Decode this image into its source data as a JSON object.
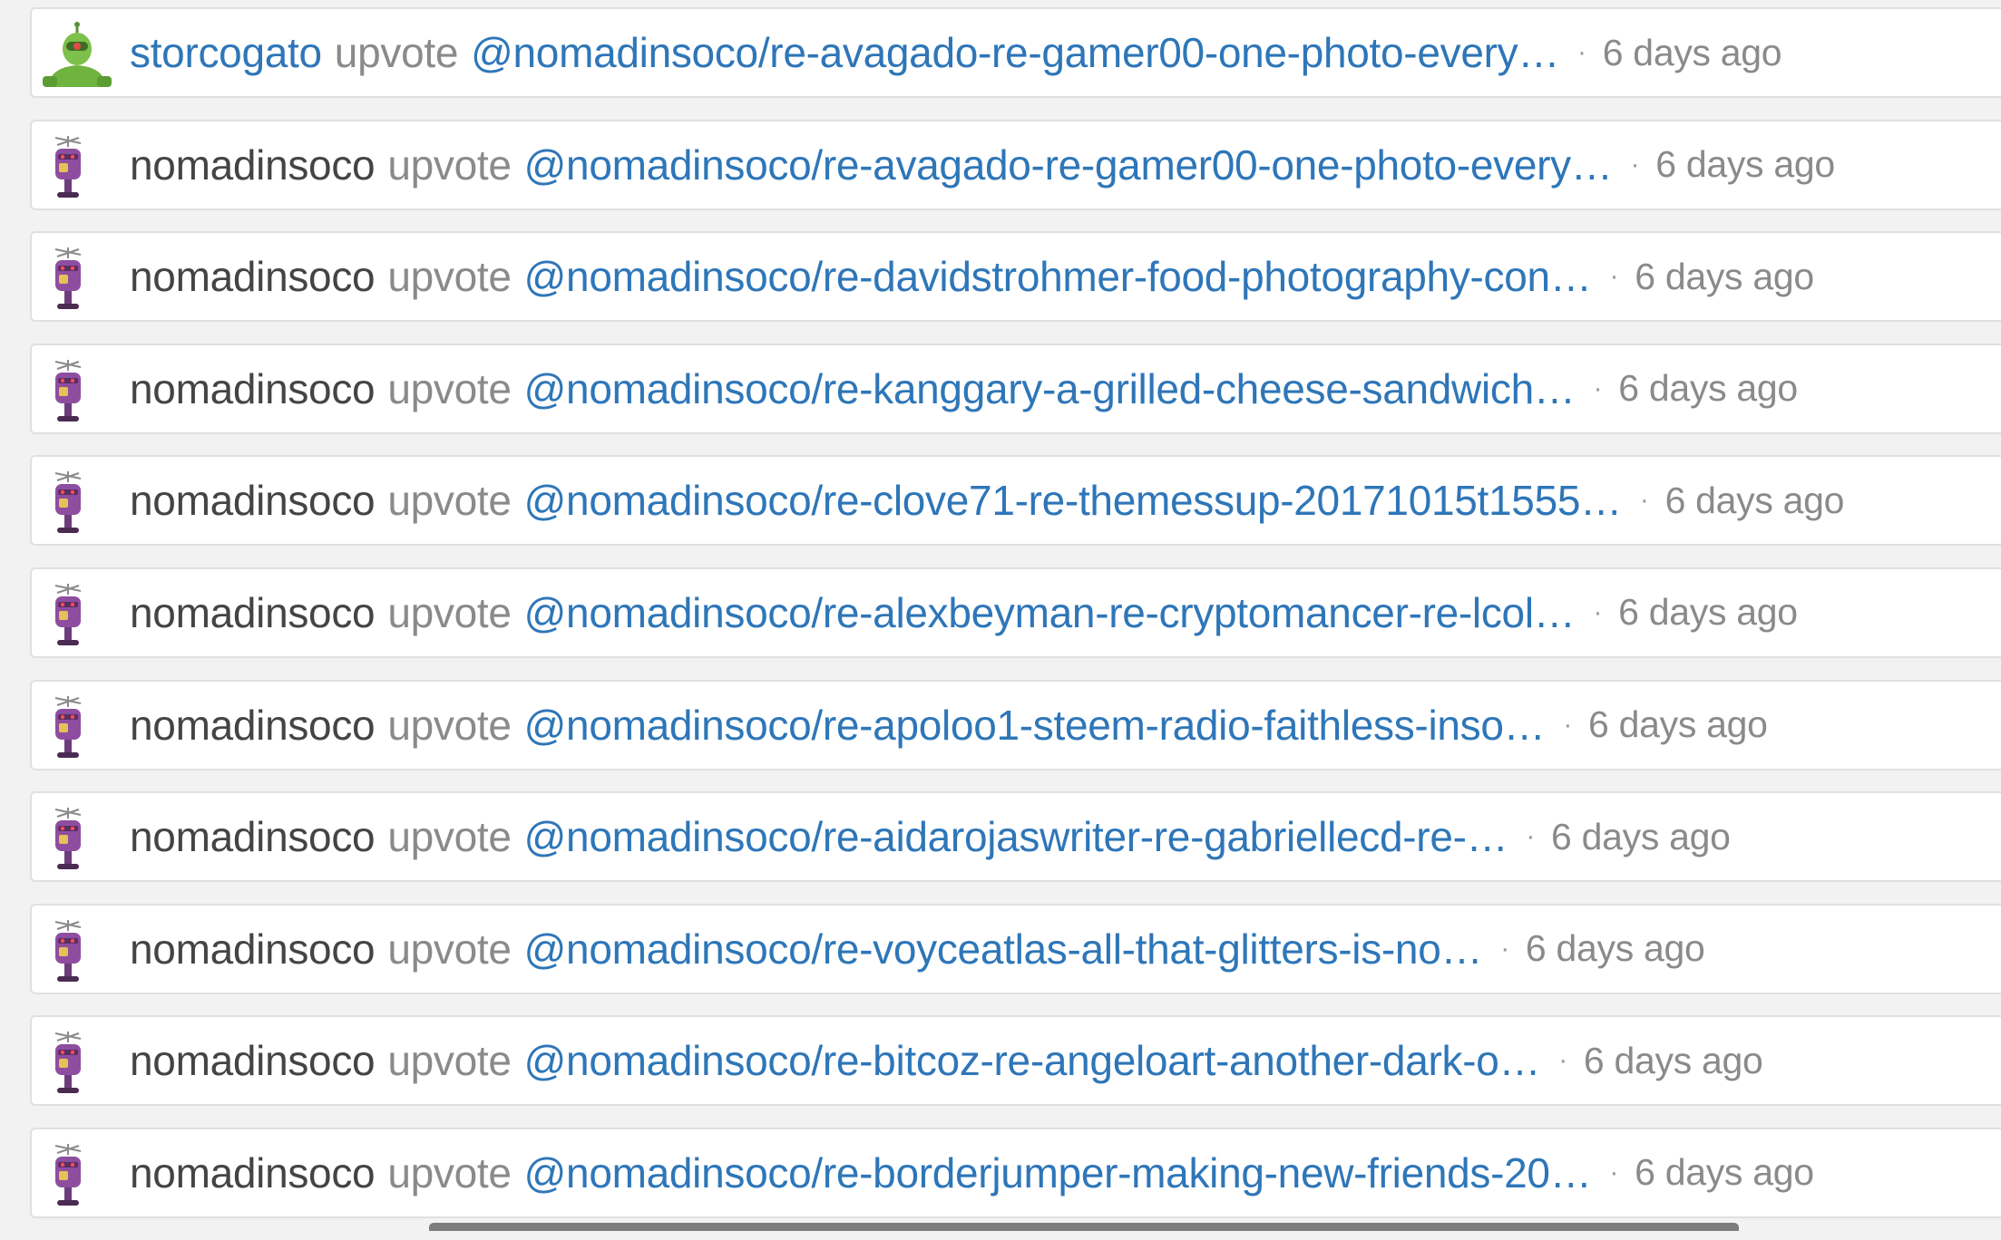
{
  "feed": {
    "items": [
      {
        "user": "storcogato",
        "action": "upvote",
        "permlink": "@nomadinsoco/re-avagado-re-gamer00-one-photo-every…",
        "separator": "·",
        "time": "6 days ago",
        "avatar": "green-robot-avatar",
        "user_is_link": true
      },
      {
        "user": "nomadinsoco",
        "action": "upvote",
        "permlink": "@nomadinsoco/re-avagado-re-gamer00-one-photo-every…",
        "separator": "·",
        "time": "6 days ago",
        "avatar": "purple-robot-avatar",
        "user_is_link": false
      },
      {
        "user": "nomadinsoco",
        "action": "upvote",
        "permlink": "@nomadinsoco/re-davidstrohmer-food-photography-con…",
        "separator": "·",
        "time": "6 days ago",
        "avatar": "purple-robot-avatar",
        "user_is_link": false
      },
      {
        "user": "nomadinsoco",
        "action": "upvote",
        "permlink": "@nomadinsoco/re-kanggary-a-grilled-cheese-sandwich…",
        "separator": "·",
        "time": "6 days ago",
        "avatar": "purple-robot-avatar",
        "user_is_link": false
      },
      {
        "user": "nomadinsoco",
        "action": "upvote",
        "permlink": "@nomadinsoco/re-clove71-re-themessup-20171015t1555…",
        "separator": "·",
        "time": "6 days ago",
        "avatar": "purple-robot-avatar",
        "user_is_link": false
      },
      {
        "user": "nomadinsoco",
        "action": "upvote",
        "permlink": "@nomadinsoco/re-alexbeyman-re-cryptomancer-re-lcol…",
        "separator": "·",
        "time": "6 days ago",
        "avatar": "purple-robot-avatar",
        "user_is_link": false
      },
      {
        "user": "nomadinsoco",
        "action": "upvote",
        "permlink": "@nomadinsoco/re-apoloo1-steem-radio-faithless-inso…",
        "separator": "·",
        "time": "6 days ago",
        "avatar": "purple-robot-avatar",
        "user_is_link": false
      },
      {
        "user": "nomadinsoco",
        "action": "upvote",
        "permlink": "@nomadinsoco/re-aidarojaswriter-re-gabriellecd-re-…",
        "separator": "·",
        "time": "6 days ago",
        "avatar": "purple-robot-avatar",
        "user_is_link": false
      },
      {
        "user": "nomadinsoco",
        "action": "upvote",
        "permlink": "@nomadinsoco/re-voyceatlas-all-that-glitters-is-no…",
        "separator": "·",
        "time": "6 days ago",
        "avatar": "purple-robot-avatar",
        "user_is_link": false
      },
      {
        "user": "nomadinsoco",
        "action": "upvote",
        "permlink": "@nomadinsoco/re-bitcoz-re-angeloart-another-dark-o…",
        "separator": "·",
        "time": "6 days ago",
        "avatar": "purple-robot-avatar",
        "user_is_link": false
      },
      {
        "user": "nomadinsoco",
        "action": "upvote",
        "permlink": "@nomadinsoco/re-borderjumper-making-new-friends-20…",
        "separator": "·",
        "time": "6 days ago",
        "avatar": "purple-robot-avatar",
        "user_is_link": false
      }
    ]
  },
  "colors": {
    "link": "#2e76b8",
    "username": "#444444",
    "muted": "#8a8a8a",
    "background": "#f2f2f2",
    "row_background": "#ffffff",
    "row_border": "#e0e0e0"
  }
}
